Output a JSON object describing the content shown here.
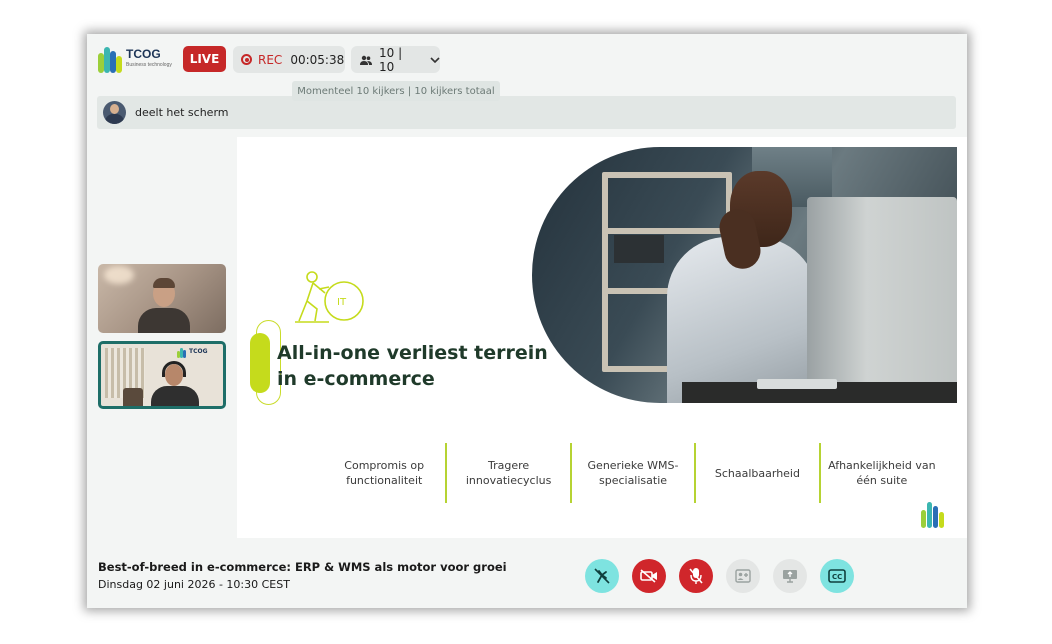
{
  "header": {
    "logo_name": "TCOG",
    "logo_tagline": "Business technology",
    "live_label": "LIVE",
    "rec_label": "REC",
    "rec_time": "00:05:38",
    "viewers_count": "10 | 10",
    "viewers_tooltip": "Momenteel 10 kijkers | 10 kijkers totaal"
  },
  "share_bar": {
    "text": "deelt het scherm"
  },
  "slide": {
    "title_line1": "All-in-one verliest terrein",
    "title_line2": "in e-commerce",
    "columns": [
      "Compromis op\nfunctionaliteit",
      "Tragere\ninnovatiecyclus",
      "Generieke WMS-\nspecialisatie",
      "Schaalbaarheid",
      "Afhankelijkheid van\néén suite"
    ],
    "illustration_label": "IT"
  },
  "participants": {
    "tile2_logo": "TCOG"
  },
  "event": {
    "title": "Best-of-breed in e-commerce: ERP & WMS als motor voor groei",
    "date": "Dinsdag 02 juni 2026 - 10:30 CEST"
  },
  "controls": [
    {
      "name": "hand-off-icon",
      "style": "teal"
    },
    {
      "name": "camera-off-icon",
      "style": "red"
    },
    {
      "name": "mic-off-icon",
      "style": "red"
    },
    {
      "name": "add-participant-icon",
      "style": "grey"
    },
    {
      "name": "screen-share-icon",
      "style": "grey"
    },
    {
      "name": "captions-icon",
      "style": "teal"
    }
  ],
  "colors": {
    "live_red": "#c62828",
    "accent_lime": "#c5db1c",
    "teal": "#7ee3e0",
    "tile_border": "#1e6e68"
  }
}
